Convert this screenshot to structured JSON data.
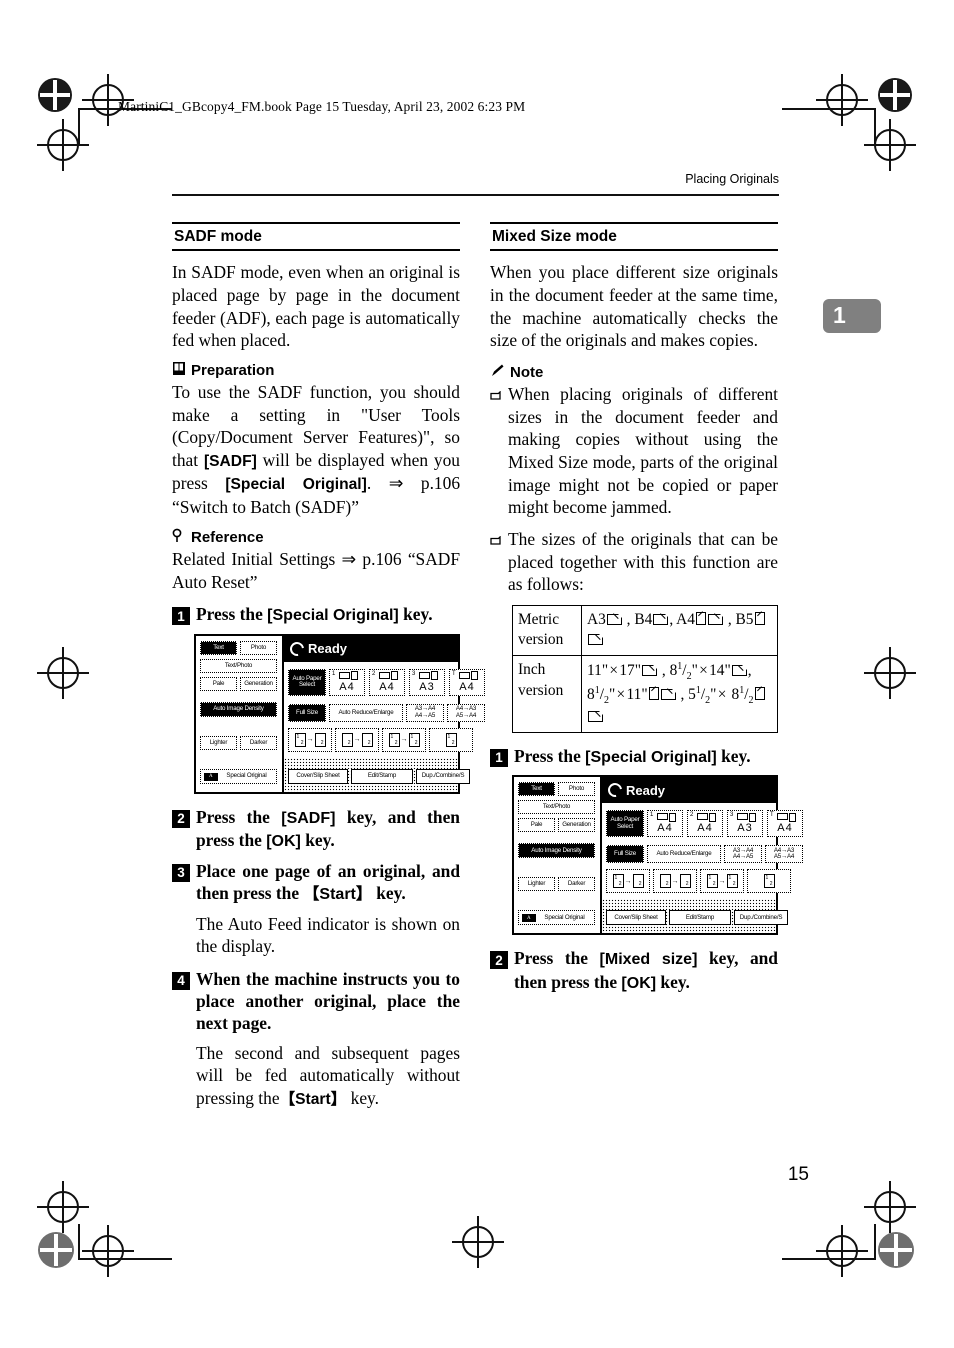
{
  "book_header": "MartiniC1_GBcopy4_FM.book  Page 15  Tuesday, April 23, 2002  6:23 PM",
  "running_head": "Placing Originals",
  "chapter_tab": "1",
  "page_number": "15",
  "left_column": {
    "section_title": "SADF mode",
    "intro": "In SADF mode, even when an original is placed page by page in the document feeder (ADF), each page is automatically fed when placed.",
    "preparation": {
      "label": "Preparation",
      "icon": "book-icon",
      "text_1": "To use the SADF function, you should make a setting in \"User Tools (Copy/Document Server Features)\", so that ",
      "key_1": "[SADF]",
      "text_2": " will be displayed when you press ",
      "key_2": "[Special Original]",
      "text_3": ". ⇒ p.106 “Switch to Batch (SADF)”"
    },
    "reference": {
      "label": "Reference",
      "icon": "magnifier-icon",
      "text": "Related Initial Settings ⇒ p.106 “SADF Auto Reset”"
    },
    "steps": [
      {
        "num": "1",
        "pre": "Press the ",
        "key": "[Special Original]",
        "post": " key."
      },
      {
        "num": "2",
        "pre": "Press the ",
        "key": "[SADF]",
        "mid": " key, and then press the ",
        "key2": "[OK]",
        "post": " key."
      },
      {
        "num": "3",
        "pre": "Place one page of an original, and then press the ",
        "key": "【Start】",
        "post": " key."
      },
      {
        "num": "4",
        "pre": "When the machine instructs you to place another original, place the next page."
      }
    ],
    "step3_note": "The Auto Feed indicator is shown on the display.",
    "step4_note_pre": "The second and subsequent pages will be fed automatically without pressing the",
    "step4_note_key": "【Start】",
    "step4_note_post": " key."
  },
  "right_column": {
    "section_title": "Mixed Size mode",
    "intro": "When you place different size originals in the document feeder at the same time, the machine automatically checks the size of the originals and makes copies.",
    "note": {
      "label": "Note",
      "icon": "pencil-icon",
      "items": [
        "When placing originals of different sizes in the document feeder and making copies without using the Mixed Size mode, parts of the original image might not be copied or paper might become jammed.",
        "The sizes of the originals that can be placed together with this function are as follows:"
      ]
    },
    "size_table": {
      "rows": [
        {
          "label": "Metric version",
          "value": "A3▱ , B4▱, A4▯▱ , B5▯▱"
        },
        {
          "label": "Inch version",
          "value": "11\" × 17\"▱ , 8 1/2\" × 14\"▱, 8 1/2\" × 11\"▯▱ , 5 1/2\" × 8 1/2▯▱"
        }
      ]
    },
    "steps": [
      {
        "num": "1",
        "pre": "Press the ",
        "key": "[Special Original]",
        "post": " key."
      },
      {
        "num": "2",
        "pre": "Press the ",
        "key": "[Mixed size]",
        "mid": " key, and then press the ",
        "key2": "[OK]",
        "post": " key."
      }
    ]
  },
  "lcd_panel": {
    "status": "Ready",
    "left_keys": [
      "Text",
      "Photo",
      "Text/Photo",
      "Pale",
      "Generation",
      "Auto Image Density",
      "Lighter",
      "Darker",
      "Special Original"
    ],
    "auto_paper_select": "Auto Paper Select",
    "trays": [
      {
        "num": "1",
        "size": "A4"
      },
      {
        "num": "2",
        "size": "A4"
      },
      {
        "num": "3",
        "size": "A3"
      },
      {
        "num": "T",
        "size": "A4"
      }
    ],
    "zoom_keys": [
      "Full Size",
      "Auto Reduce/Enlarge",
      "A3→A4 A4→A5",
      "A4→A3 A5→A4"
    ],
    "bottom_tabs": [
      "Cover/Slip Sheet",
      "Edit/Stamp",
      "Dup./Combine/S"
    ]
  }
}
